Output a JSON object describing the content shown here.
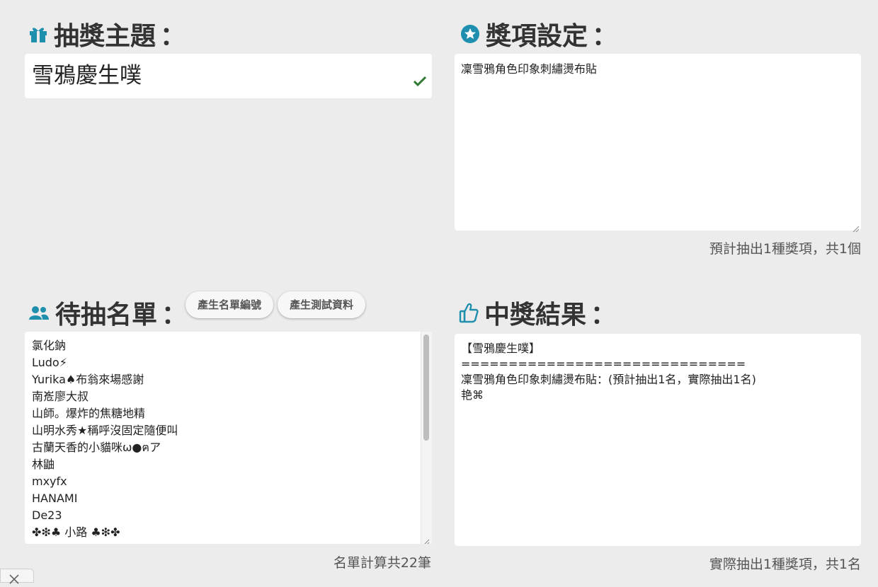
{
  "theme": {
    "heading": "抽獎主題",
    "colon": "：",
    "icon": "gift-icon",
    "value": "雪鴉慶生噗",
    "valid_icon": "check-icon",
    "accent": "#1f8fae"
  },
  "prizes": {
    "heading": "獎項設定",
    "colon": "：",
    "icon": "star-circle-icon",
    "text": "凜雪鴉角色印象刺繡燙布貼",
    "summary": "預計抽出1種獎項，共1個"
  },
  "entrants": {
    "heading": "待抽名單",
    "colon": "：",
    "icon": "people-icon",
    "buttons": [
      "產生名單編號",
      "產生測試資料"
    ],
    "items": [
      "氯化鈉",
      "Ludo⚡",
      "Yurika♠布翁來場感謝",
      "南峞廖大叔",
      "山師。爆炸的焦糖地精",
      "山明水秀★稱呼沒固定隨便叫",
      "古蘭天香的小貓咪ω●ฅア",
      "林鼬",
      "mxyfx",
      "HANAMI",
      "De23",
      "✤❇♣ 小路 ♣❇✤"
    ],
    "summary": "名單計算共22筆"
  },
  "results": {
    "heading": "中獎結果",
    "colon": "：",
    "icon": "thumbs-up-icon",
    "lines": [
      "【雪鴉慶生噗】",
      "==============================",
      "凜雪鴉角色印象刺繡燙布貼：(預計抽出1名，實際抽出1名)",
      "艳⌘"
    ],
    "summary": "實際抽出1種獎項，共1名"
  },
  "colors": {
    "accent": "#1f8fae",
    "check": "#2e7d32",
    "background": "#ececec"
  }
}
